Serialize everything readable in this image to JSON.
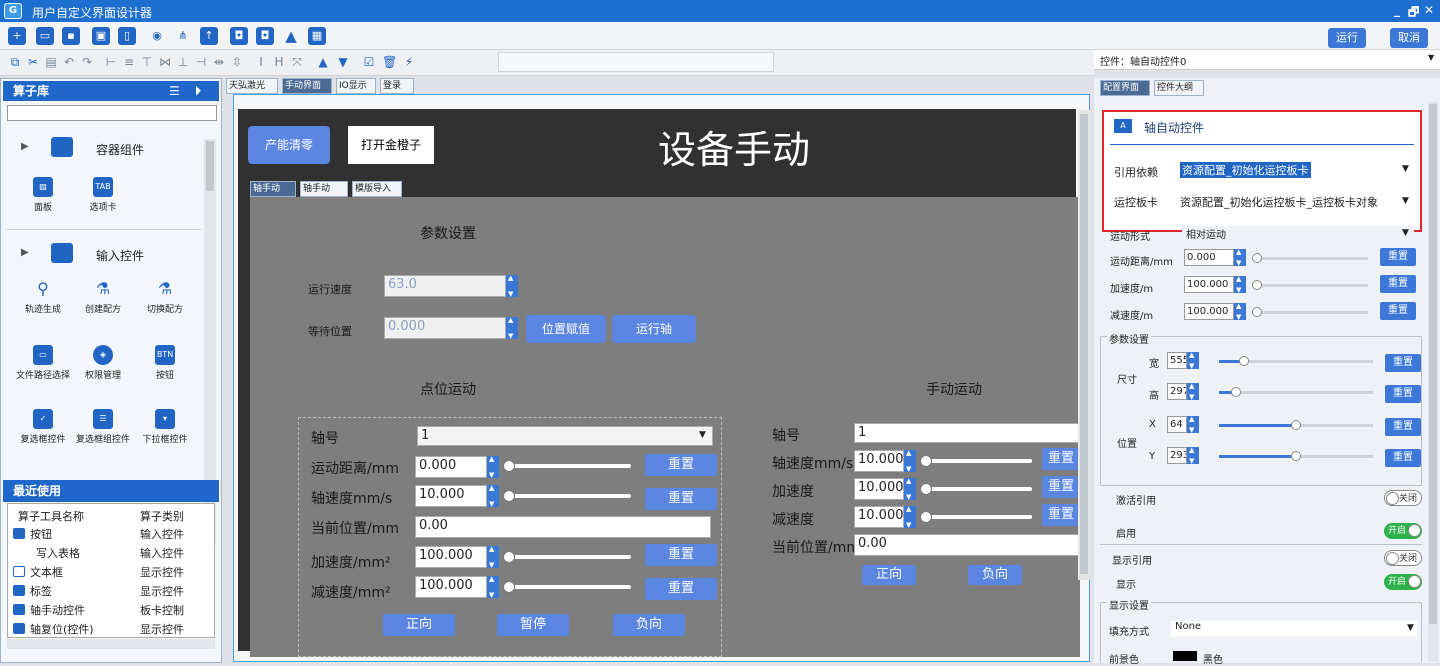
{
  "window": {
    "title": "用户自定义界面设计器",
    "logo": "G",
    "minimize": "_",
    "restore": "🗗",
    "close": "✕"
  },
  "toolbar": {
    "run": "运行",
    "cancel": "取消",
    "control_label": "控件：轴自动控件0"
  },
  "left": {
    "title": "算子库",
    "search_placeholder": "",
    "categories": [
      {
        "label": "容器组件"
      },
      {
        "label": "输入控件"
      }
    ],
    "components": [
      {
        "label": "面板",
        "icon": "panel-icon"
      },
      {
        "label": "选项卡",
        "icon": "tab-icon",
        "badge": "TAB"
      },
      {
        "label": "轨迹生成",
        "icon": "track-icon"
      },
      {
        "label": "创建配方",
        "icon": "flask-icon"
      },
      {
        "label": "切换配方",
        "icon": "flask-icon"
      },
      {
        "label": "文件路径选择",
        "icon": "folder-icon"
      },
      {
        "label": "权限管理",
        "icon": "layers-icon"
      },
      {
        "label": "按钮",
        "icon": "button-icon",
        "badge": "BTN"
      },
      {
        "label": "复选框控件",
        "icon": "checkbox-icon"
      },
      {
        "label": "复选框组控件",
        "icon": "list-icon"
      },
      {
        "label": "下拉框控件",
        "icon": "dropdown-icon"
      }
    ],
    "recent_title": "最近使用",
    "recent_headers": [
      "算子工具名称",
      "算子类别"
    ],
    "recent": [
      {
        "name": "按钮",
        "type": "输入控件"
      },
      {
        "name": "写入表格",
        "type": "输入控件"
      },
      {
        "name": "文本框",
        "type": "显示控件"
      },
      {
        "name": "标签",
        "type": "显示控件"
      },
      {
        "name": "轴手动控件",
        "type": "板卡控制"
      },
      {
        "name": "轴复位(控件)",
        "type": "显示控件"
      }
    ]
  },
  "center": {
    "tabs": [
      "天弘激光",
      "手动界面",
      "IO显示",
      "登录"
    ],
    "btn_reset_capacity": "产能清零",
    "btn_open_box": "打开金橙子",
    "title": "设备手动",
    "inner_tabs": [
      "轴手动",
      "轴手动",
      "模版导入"
    ],
    "params_title": "参数设置",
    "run_speed_label": "运行速度",
    "run_speed": "63.0",
    "wait_pos_label": "等待位置",
    "wait_pos": "0.000",
    "btn_pos_assign": "位置赋值",
    "btn_run_axis": "运行轴",
    "point": {
      "title": "点位运动",
      "axis_label": "轴号",
      "axis": "1",
      "dist_label": "运动距离/mm",
      "dist": "0.000",
      "speed_label": "轴速度mm/s",
      "speed": "10.000",
      "cur_label": "当前位置/mm",
      "cur": "0.00",
      "acc_label": "加速度/mm²",
      "acc": "100.000",
      "dec_label": "减速度/mm²",
      "dec": "100.000",
      "reset": "重置",
      "fwd": "正向",
      "pause": "暂停",
      "rev": "负向"
    },
    "manual": {
      "title": "手动运动",
      "axis_label": "轴号",
      "axis": "1",
      "speed_label": "轴速度mm/s",
      "speed": "10.000",
      "acc_label": "加速度",
      "acc": "10.000",
      "dec_label": "减速度",
      "dec": "10.000",
      "cur_label": "当前位置/mm",
      "cur": "0.00",
      "reset": "重置",
      "fwd": "正向",
      "rev": "负向"
    }
  },
  "right": {
    "tabs": [
      "配置界面",
      "控件大纲"
    ],
    "panel_title": "轴自动控件",
    "ref_label": "引用依赖",
    "ref_value": "资源配置_初始化运控板卡",
    "card_label": "运控板卡",
    "card_value": "资源配置_初始化运控板卡_运控板卡对象",
    "motion_mode_label": "运动形式",
    "motion_mode": "相对运动",
    "dist_label": "运动距离/mm",
    "dist": "0.000",
    "acc_label": "加速度/m",
    "acc": "100.000",
    "dec_label": "减速度/m",
    "dec": "100.000",
    "reset": "重置",
    "params_group": "参数设置",
    "size_label": "尺寸",
    "width_label": "宽",
    "width": "555",
    "height_label": "高",
    "height": "297",
    "pos_label": "位置",
    "x_label": "X",
    "x": "64",
    "y_label": "Y",
    "y": "293",
    "activate_ref_label": "激活引用",
    "activate_ref": "关闭",
    "enable_label": "启用",
    "enable": "开启",
    "show_ref_label": "显示引用",
    "show_ref": "关闭",
    "show_label": "显示",
    "show": "开启",
    "display_group": "显示设置",
    "fill_label": "填充方式",
    "fill": "None",
    "fg_label": "前景色",
    "fg": "黑色"
  },
  "colors": {
    "accent": "#1f67c9",
    "button": "#5a85e0",
    "highlight": "#e0262b",
    "toggle_on": "#2db14a"
  }
}
